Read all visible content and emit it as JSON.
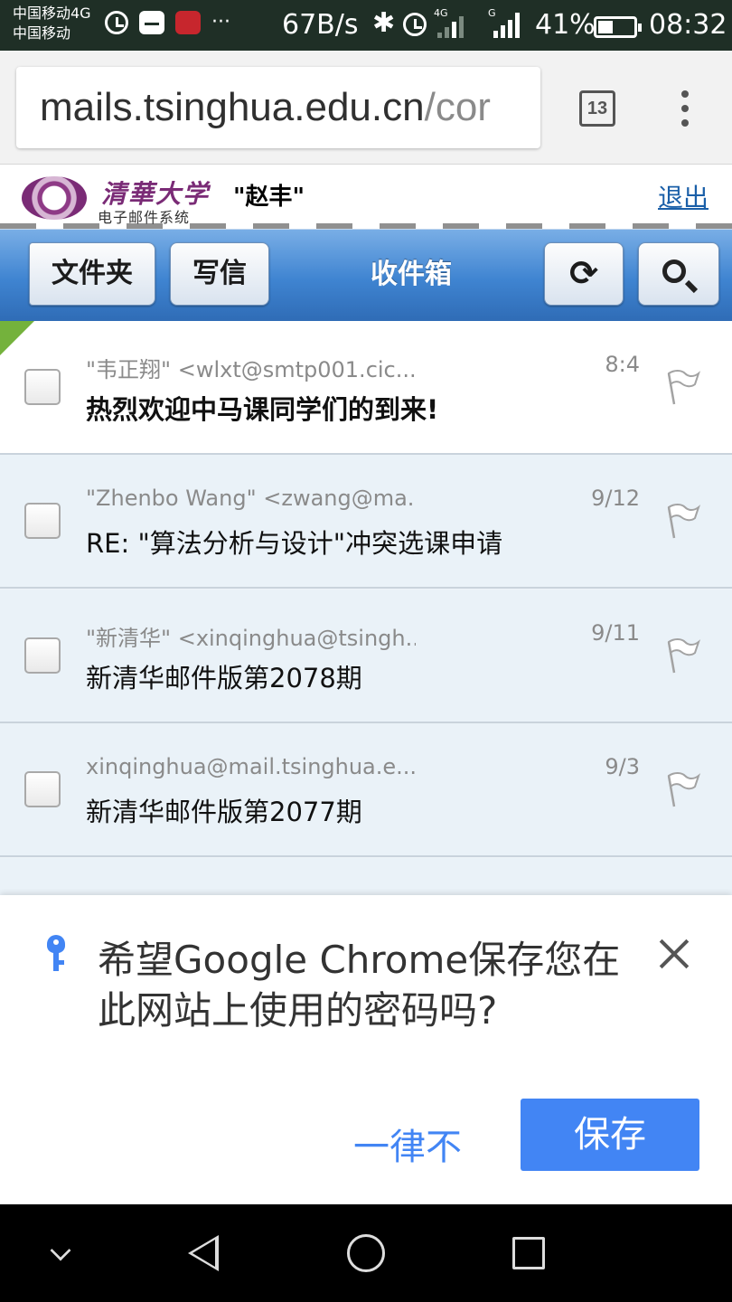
{
  "status_bar": {
    "carrier_line1": "中国移动4G",
    "carrier_line2": "中国移动",
    "more_indicator": "···",
    "net_speed": "67B/s",
    "network_1": "4G",
    "network_2": "G",
    "battery_percent": "41%",
    "battery_level": 0.41,
    "time": "08:32"
  },
  "browser": {
    "url_host": "mails.tsinghua.edu.cn",
    "url_path": "/cor",
    "tab_count": "13"
  },
  "site_header": {
    "logo_text": "清華大学",
    "logo_subtext": "电子邮件系统",
    "username": "\"赵丰\"",
    "logout_label": "退出"
  },
  "nav": {
    "folders_label": "文件夹",
    "compose_label": "写信",
    "title": "收件箱"
  },
  "mail_list": [
    {
      "sender": "\"韦正翔\" <wlxt@smtp001.cic...",
      "date": "8:4",
      "subject": "热烈欢迎中马课同学们的到来!",
      "unread": true
    },
    {
      "sender": "\"Zhenbo Wang\" <zwang@ma...",
      "date": "9/12",
      "subject": "RE: \"算法分析与设计\"冲突选课申请",
      "unread": false
    },
    {
      "sender": "\"新清华\" <xinqinghua@tsingh..",
      "date": "9/11",
      "subject": "新清华邮件版第2078期",
      "unread": false
    },
    {
      "sender": "xinqinghua@mail.tsinghua.e...",
      "date": "9/3",
      "subject": "新清华邮件版第2077期",
      "unread": false
    }
  ],
  "password_dialog": {
    "message": "希望Google Chrome保存您在此网站上使用的密码吗?",
    "never_label": "一律不",
    "save_label": "保存"
  },
  "colors": {
    "status_bar_bg": "#1f2f26",
    "nav_blue": "#3f84d1",
    "google_blue": "#4285f4",
    "logout_link": "#1a5fa8",
    "tsinghua_purple": "#7a2b76"
  },
  "icons": {
    "alarm": "alarm-icon",
    "bluetooth": "bluetooth-icon",
    "refresh": "refresh-icon",
    "search": "search-icon",
    "flag": "flag-icon",
    "key": "key-icon",
    "close": "close-icon"
  }
}
